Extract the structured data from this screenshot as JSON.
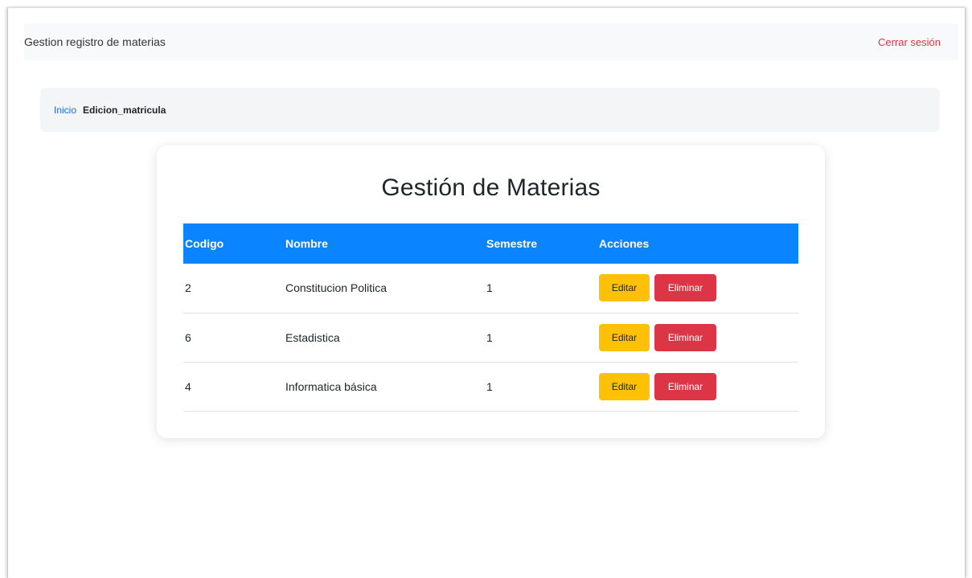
{
  "navbar": {
    "brand": "Gestion registro de materias",
    "logout": "Cerrar sesión"
  },
  "breadcrumb": {
    "home": "Inicio",
    "current": "Edicion_matricula"
  },
  "card": {
    "title": "Gestión de Materias"
  },
  "table": {
    "headers": [
      "Codigo",
      "Nombre",
      "Semestre",
      "Acciones"
    ],
    "rows": [
      {
        "codigo": "2",
        "nombre": "Constitucion Politica",
        "semestre": "1"
      },
      {
        "codigo": "6",
        "nombre": "Estadistica",
        "semestre": "1"
      },
      {
        "codigo": "4",
        "nombre": "Informatica básica",
        "semestre": "1"
      }
    ],
    "edit_label": "Editar",
    "delete_label": "Eliminar"
  },
  "colors": {
    "header_bg": "#0a84ff",
    "edit_btn": "#ffc107",
    "delete_btn": "#dc3545",
    "link": "#0d6efd",
    "logout": "#dc3545"
  }
}
